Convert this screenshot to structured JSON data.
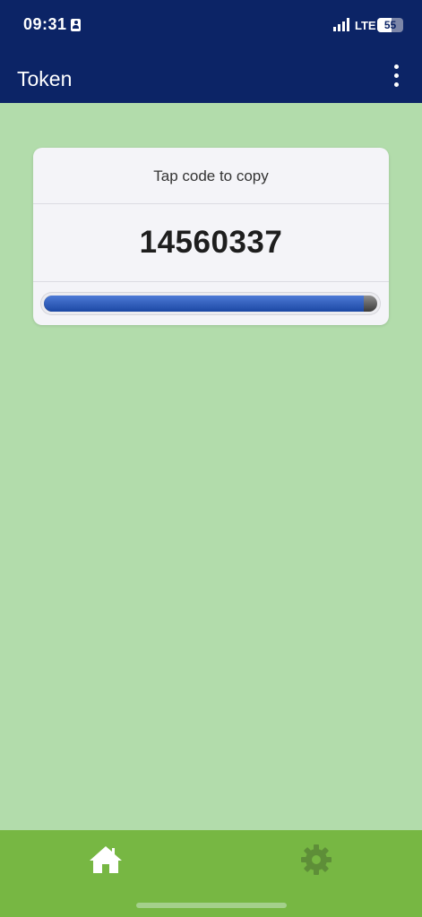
{
  "status_bar": {
    "time": "09:31",
    "network": "LTE",
    "battery_level": "55",
    "battery_fraction": 0.55
  },
  "app_bar": {
    "title": "Token",
    "menu_icon": "more-vertical-icon"
  },
  "token_card": {
    "hint": "Tap code to copy",
    "code": "14560337",
    "time_remaining_fraction": 0.96
  },
  "bottom_nav": {
    "items": [
      {
        "icon": "home-icon",
        "active": true
      },
      {
        "icon": "gear-icon",
        "active": false
      }
    ]
  },
  "colors": {
    "header": "#0c2466",
    "background": "#b2dcab",
    "card": "#f4f4f8",
    "nav": "#77b743",
    "progress": "#1c48a4",
    "nav_active": "#ffffff",
    "nav_inactive": "#5e8e38"
  }
}
